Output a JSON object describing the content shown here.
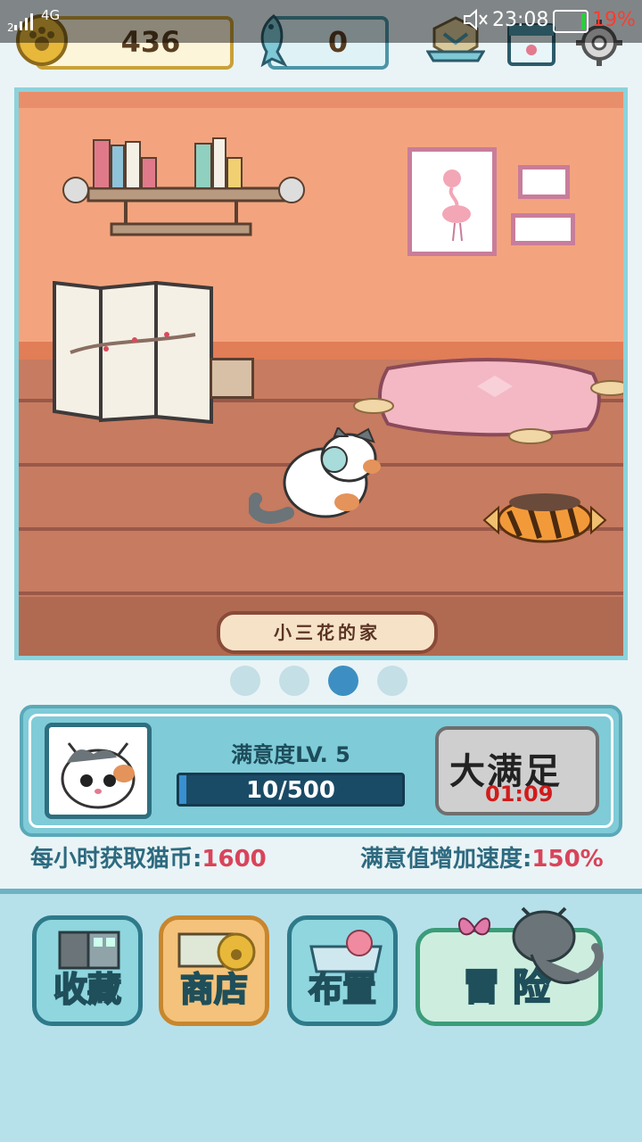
{
  "status_bar": {
    "signal_sub": "2",
    "network": "4G",
    "mute_icon": "mute-icon",
    "time": "23:08",
    "battery_percent": "19%"
  },
  "top_bar": {
    "coins": "436",
    "fish": "0"
  },
  "room": {
    "name": "小三花的家"
  },
  "page_dots": {
    "count": 4,
    "active_index": 2
  },
  "cat_panel": {
    "satisfaction_label": "满意度LV. 5",
    "satisfaction_progress": "10/500",
    "satisfaction_fraction": 0.02,
    "big_button_label": "大满足",
    "timer": "01:09"
  },
  "stats": {
    "coins_per_hour_label": "每小时获取猫币:",
    "coins_per_hour_value": "1600",
    "satisfaction_speed_label": "满意值增加速度:",
    "satisfaction_speed_value": "150%"
  },
  "nav": {
    "collection": "收藏",
    "shop": "商店",
    "arrange": "布置",
    "adventure": "冒险"
  },
  "colors": {
    "accent_blue": "#3d8fc3",
    "stat_value_red": "#d9445a",
    "timer_red": "#d21b1b"
  }
}
